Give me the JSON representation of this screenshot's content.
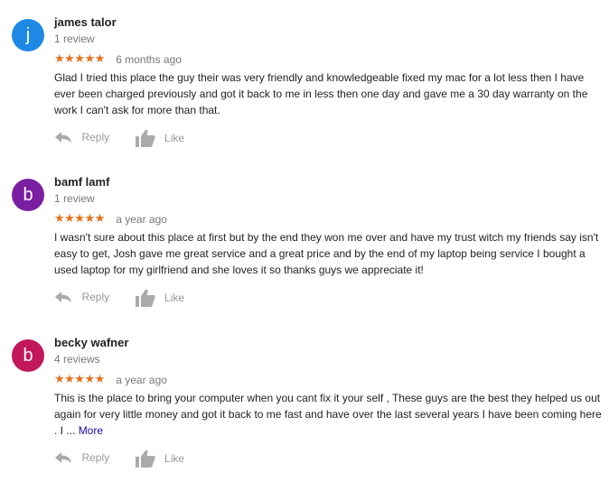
{
  "reviews": [
    {
      "avatar_letter": "j",
      "avatar_color": "#1e88e5",
      "author": "james talor",
      "review_count": "1 review",
      "stars": "★★★★★",
      "date": "6 months ago",
      "text": "Glad I tried this place the guy their was very friendly and knowledgeable fixed my mac for a lot less then I have ever been charged previously and got it back to me in less then one day and gave me a 30 day warranty on the work I can't ask for more than that.",
      "more": "",
      "reply_label": "Reply",
      "like_label": "Like"
    },
    {
      "avatar_letter": "b",
      "avatar_color": "#7b1fa2",
      "author": "bamf lamf",
      "review_count": "1 review",
      "stars": "★★★★★",
      "date": "a year ago",
      "text": "I wasn't sure about this place at first but by the end they won me over and have my trust witch my friends say isn't easy to get, Josh gave me great service and a great price and by the end of my laptop being service I bought a used laptop for my girlfriend and she loves it so thanks guys we appreciate it!",
      "more": "",
      "reply_label": "Reply",
      "like_label": "Like"
    },
    {
      "avatar_letter": "b",
      "avatar_color": "#c2185b",
      "author": "becky wafner",
      "review_count": "4 reviews",
      "stars": "★★★★★",
      "date": "a year ago",
      "text": "This is the place to bring your computer when you cant fix it your self , These guys are the best they helped us out again for very little money and got it back to me fast and have over the last several years I have been coming here . I ...",
      "more": "More",
      "reply_label": "Reply",
      "like_label": "Like"
    }
  ],
  "colors": {
    "star": "#e7711b",
    "link": "#1a0dab",
    "muted": "#777777",
    "action": "#999999",
    "icon": "#aaaaaa"
  }
}
